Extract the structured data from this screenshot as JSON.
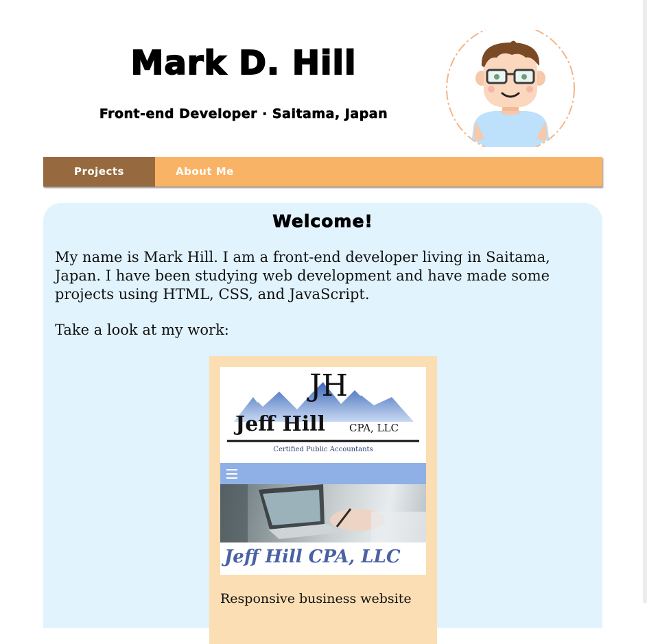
{
  "header": {
    "name": "Mark D. Hill",
    "subtitle": "Front-end Developer · Saitama, Japan",
    "avatar_icon": "developer-avatar-icon"
  },
  "nav": {
    "items": [
      {
        "label": "Projects",
        "active": true
      },
      {
        "label": "About Me",
        "active": false
      }
    ]
  },
  "main": {
    "heading": "Welcome!",
    "intro": "My name is Mark Hill. I am a front-end developer living in Saitama, Japan. I have been studying web development and have made some projects using HTML, CSS, and JavaScript.",
    "lookat": "Take a look at my work:",
    "project": {
      "logo_initials": "JH",
      "logo_name": "Jeff Hill",
      "logo_suffix": "CPA, LLC",
      "logo_tagline": "Certified Public Accountants",
      "company": "Jeff Hill CPA, LLC",
      "description": "Responsive business website"
    }
  },
  "colors": {
    "nav_bg": "#f8b366",
    "nav_active_bg": "#966a3e",
    "panel_bg": "#e1f3fd",
    "card_bg": "#fbdeb3",
    "thumb_nav_bg": "#8fb0e6",
    "thumb_title": "#4a62a4"
  }
}
